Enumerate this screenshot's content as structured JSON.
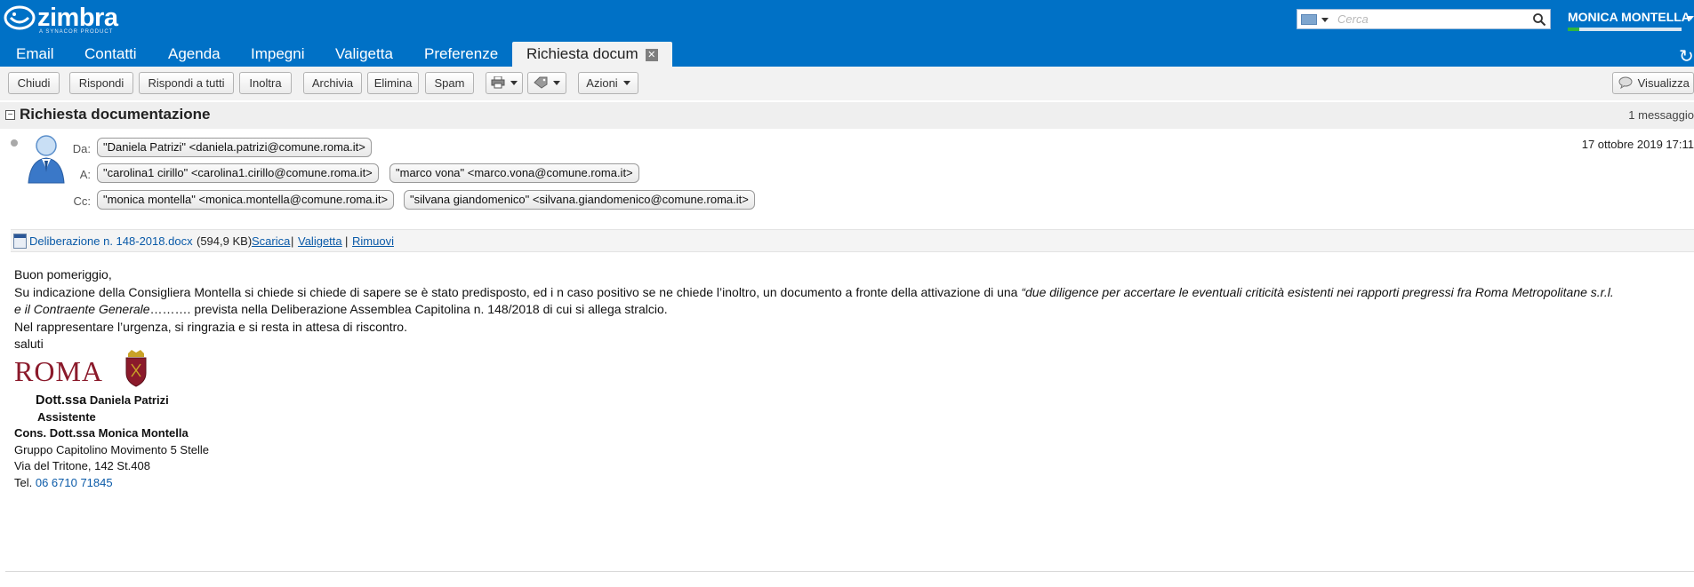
{
  "app": {
    "logo_text": "zimbra",
    "logo_sub": "A SYNACOR PRODUCT",
    "brand_color": "#0071c6"
  },
  "search": {
    "placeholder": "Cerca"
  },
  "user": {
    "name": "MONICA MONTELLA",
    "quota_fill_fraction": 0.1
  },
  "tabs": [
    {
      "label": "Email"
    },
    {
      "label": "Contatti"
    },
    {
      "label": "Agenda"
    },
    {
      "label": "Impegni"
    },
    {
      "label": "Valigetta"
    },
    {
      "label": "Preferenze"
    },
    {
      "label": "Richiesta docum",
      "active": true
    }
  ],
  "toolbar": {
    "close": "Chiudi",
    "reply": "Rispondi",
    "reply_all": "Rispondi a tutti",
    "forward": "Inoltra",
    "archive": "Archivia",
    "delete": "Elimina",
    "spam": "Spam",
    "actions": "Azioni",
    "view": "Visualizza",
    "print_icon": "printer-icon",
    "tag_icon": "tag-icon"
  },
  "message": {
    "subject": "Richiesta documentazione",
    "count": "1 messaggio",
    "date": "17 ottobre 2019 17:11",
    "labels": {
      "from": "Da:",
      "to": "A:",
      "cc": "Cc:"
    },
    "from": [
      "\"Daniela Patrizi\" <daniela.patrizi@comune.roma.it>"
    ],
    "to": [
      "\"carolina1 cirillo\" <carolina1.cirillo@comune.roma.it>",
      "\"marco vona\" <marco.vona@comune.roma.it>"
    ],
    "cc": [
      "\"monica montella\" <monica.montella@comune.roma.it>",
      "\"silvana giandomenico\" <silvana.giandomenico@comune.roma.it>"
    ]
  },
  "attachment": {
    "name": "Deliberazione n. 148-2018.docx",
    "size": "(594,9 KB)",
    "download": "Scarica",
    "briefcase": "Valigetta",
    "remove": "Rimuovi",
    "sep": "|"
  },
  "body": {
    "greeting": "Buon pomeriggio,",
    "line2_start": "Su indicazione della Consigliera Montella si chiede si chiede di sapere se è stato predisposto, ed i n caso positivo se ne chiede l’inoltro, un documento a fronte della attivazione di una ",
    "line2_italic": "“due diligence per accertare le eventuali criticità esistenti nei rapporti pregressi fra Roma Metropolitane  s.r.l.",
    "line3_italic": "e il Contraente Generale",
    "line3_rest": "………. prevista nella Deliberazione Assemblea Capitolina n. 148/2018 di cui si allega stralcio.",
    "line4": "Nel rappresentare l’urgenza, si ringrazia e si resta in attesa di riscontro.",
    "line5": "saluti"
  },
  "signature": {
    "logo_word": "ROMA",
    "title": "Dott.ssa",
    "name": "Daniela Patrizi",
    "role": "Assistente",
    "org1": "Cons. Dott.ssa Monica Montella",
    "org2": "Gruppo Capitolino Movimento 5 Stelle",
    "address": "Via del Tritone, 142 St.408",
    "tel_label": "Tel. ",
    "tel": "06 6710 71845"
  }
}
